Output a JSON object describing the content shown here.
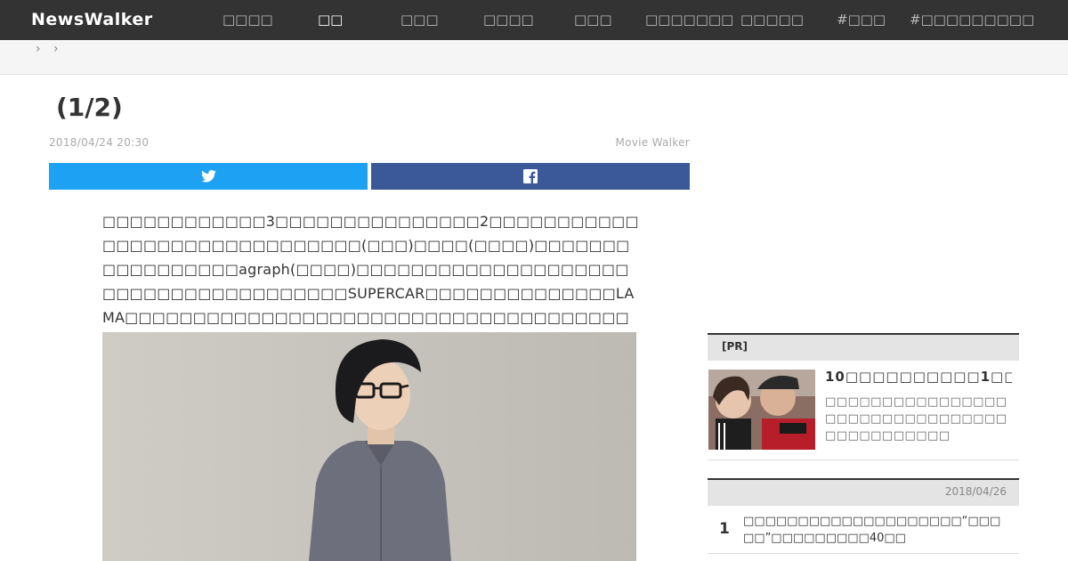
{
  "header": {
    "logo": "NewsWalker",
    "nav": [
      {
        "label": "□□□□",
        "active": false
      },
      {
        "label": "□□",
        "active": true
      },
      {
        "label": "□□□",
        "active": false
      },
      {
        "label": "□□□□",
        "active": false
      },
      {
        "label": "□□□",
        "active": false
      },
      {
        "label": "□□□□□□□",
        "active": false
      },
      {
        "label": "□□□□□",
        "active": false
      },
      {
        "label": "#□□□",
        "active": false
      },
      {
        "label": "#□□□□□□□□□",
        "active": false
      }
    ]
  },
  "breadcrumb": [
    "›",
    "›"
  ],
  "article": {
    "title": "(1/2)",
    "date": "2018/04/24 20:30",
    "source": "Movie Walker",
    "share_twitter_icon": "twitter-icon",
    "share_facebook_icon": "facebook-icon",
    "body": "□□□□□□□□□□□□3□□□□□□□□□□□□□□□2□□□□□□□□□□□□□□□□□□□□□□□□□□□□□□(□□□)□□□□(□□□□)□□□□□□□□□□□□□□□□□agraph(□□□□)□□□□□□□□□□□□□□□□□□□□□□□□□□□□□□□□□□□□□□SUPERCAR□□□□□□□□□□□□□□LAMA□□□□□□□□□□□□□□□□□□□□□□□□□□□□□□□□□□□□□□□□"
  },
  "sidebar": {
    "pr": {
      "label": "[PR]",
      "title": "10□□□□□□□□□□1□□□□□□",
      "desc": "□□□□□□□□□□□□□□□□□□□□□□□□□□□□□□□□□□□□□□□□□□□"
    },
    "ranking": {
      "date": "2018/04/26",
      "items": [
        {
          "rank": "1",
          "title": "□□□□□□□□□□□□□□□□□□□□“□□□□□”□□□□□□□□□40□□"
        }
      ]
    }
  },
  "colors": {
    "topbar": "#333333",
    "twitter": "#1da1f2",
    "facebook": "#3b5998"
  }
}
